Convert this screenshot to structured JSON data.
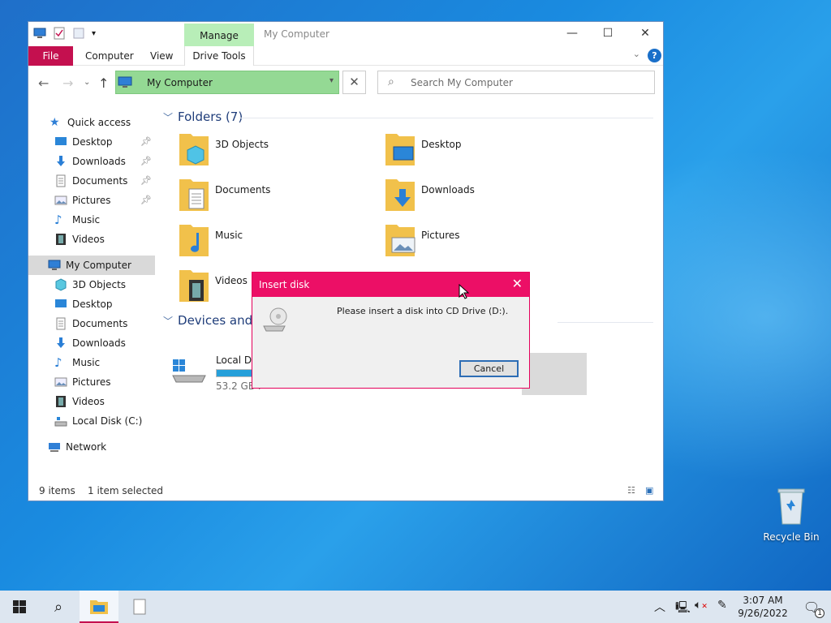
{
  "explorer": {
    "title": "My Computer",
    "manage_tab": "Manage",
    "ribbon": {
      "file": "File",
      "computer": "Computer",
      "view": "View",
      "drive_tools": "Drive Tools"
    },
    "address": "My Computer",
    "search_placeholder": "Search My Computer",
    "sidebar": {
      "quick_access": "Quick access",
      "quick_items": [
        "Desktop",
        "Downloads",
        "Documents",
        "Pictures",
        "Music",
        "Videos"
      ],
      "my_computer": "My Computer",
      "pc_items": [
        "3D Objects",
        "Desktop",
        "Documents",
        "Downloads",
        "Music",
        "Pictures",
        "Videos",
        "Local Disk (C:)"
      ],
      "network": "Network"
    },
    "folders_title": "Folders (7)",
    "folders": [
      "3D Objects",
      "Desktop",
      "Documents",
      "Downloads",
      "Music",
      "Pictures",
      "Videos"
    ],
    "devices_title": "Devices and di",
    "drive": {
      "name": "Local Dis",
      "free": "53.2 GB f",
      "used_fraction": 0.3
    },
    "status": {
      "items": "9 items",
      "selected": "1 item selected"
    }
  },
  "dialog": {
    "title": "Insert disk",
    "message": "Please insert a disk into CD Drive (D:).",
    "cancel": "Cancel"
  },
  "desktop": {
    "recycle_bin": "Recycle Bin"
  },
  "taskbar": {
    "time": "3:07 AM",
    "date": "9/26/2022",
    "notifications": "1"
  },
  "colors": {
    "accent": "#c4104f",
    "dialog_title": "#ec0f66",
    "address_bg": "#94d994"
  }
}
